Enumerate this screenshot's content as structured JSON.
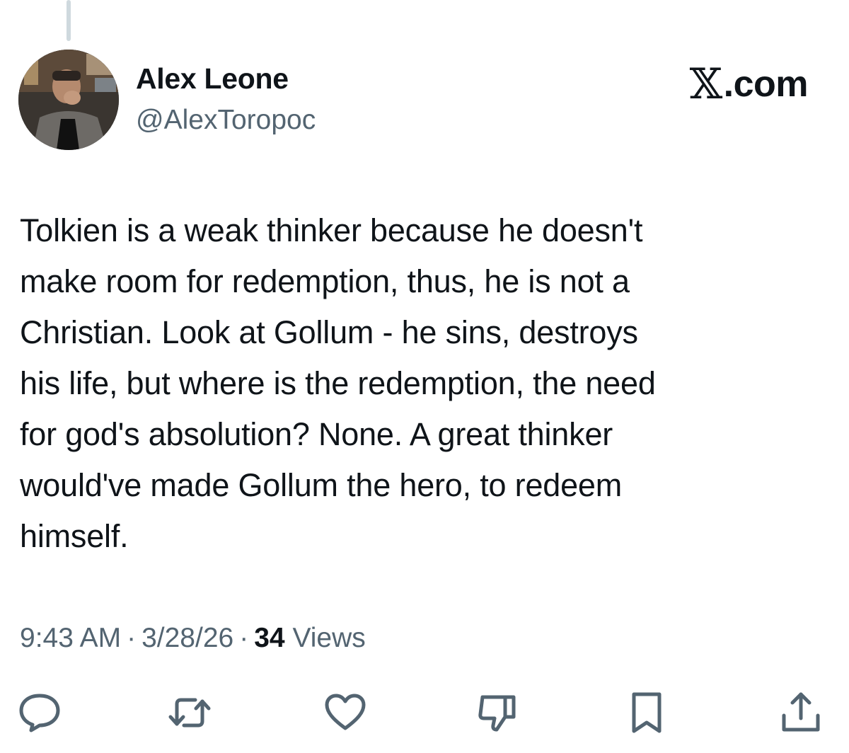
{
  "tweet": {
    "display_name": "Alex Leone",
    "handle": "@AlexToropoc",
    "brand": "X.com",
    "brand_mark": "𝕏",
    "brand_suffix": ".com",
    "body": "Tolkien is a weak thinker because he doesn't\nmake room for redemption, thus, he is not a\nChristian. Look at Gollum - he sins, destroys\nhis life, but where is the redemption, the need\nfor god's absolution? None. A great thinker\nwould've made Gollum the hero, to redeem\nhimself.",
    "time": "9:43 AM",
    "date": "3/28/26",
    "separator": "·",
    "views_count": "34",
    "views_label": "Views"
  },
  "actions": [
    {
      "name": "reply",
      "icon": "speech-bubble-icon"
    },
    {
      "name": "repost",
      "icon": "repost-arrows-icon"
    },
    {
      "name": "like",
      "icon": "heart-icon"
    },
    {
      "name": "dislike",
      "icon": "thumbs-down-icon"
    },
    {
      "name": "bookmark",
      "icon": "bookmark-icon"
    },
    {
      "name": "share",
      "icon": "share-upload-icon"
    }
  ],
  "colors": {
    "text": "#0f1419",
    "secondary": "#536471",
    "thread_line": "#cfd9de"
  }
}
